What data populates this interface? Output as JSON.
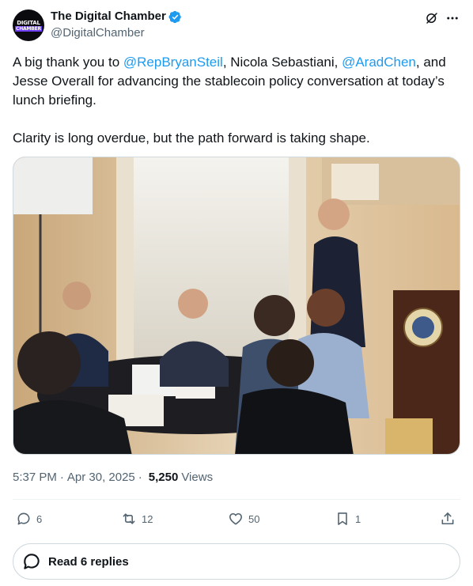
{
  "author": {
    "avatar_line1": "DIGITAL",
    "avatar_line2": "CHAMBER",
    "display_name": "The Digital Chamber",
    "handle": "@DigitalChamber",
    "verified_color": "#1d9bf0"
  },
  "header_icons": [
    "grok-icon",
    "more-icon"
  ],
  "tweet": {
    "t1": "A big thank you to ",
    "m1": "@RepBryanSteil",
    "t2": ", Nicola Sebastiani, ",
    "m2": "@AradChen",
    "t3": ", and Jesse Overall for advancing the stablecoin policy conversation at today’s lunch briefing.",
    "p2": "Clarity is long overdue, but the path forward is taking shape."
  },
  "meta": {
    "time": "5:37 PM",
    "separator1": "·",
    "date": "Apr 30, 2025",
    "separator2": "·",
    "views_count": "5,250",
    "views_label": "Views"
  },
  "actions": {
    "replies": "6",
    "reposts": "12",
    "likes": "50",
    "bookmarks": "1"
  },
  "read_replies_label": "Read 6 replies",
  "colors": {
    "text": "#0f1419",
    "secondary": "#536471",
    "link": "#1d9bf0",
    "border": "#cfd9de"
  }
}
